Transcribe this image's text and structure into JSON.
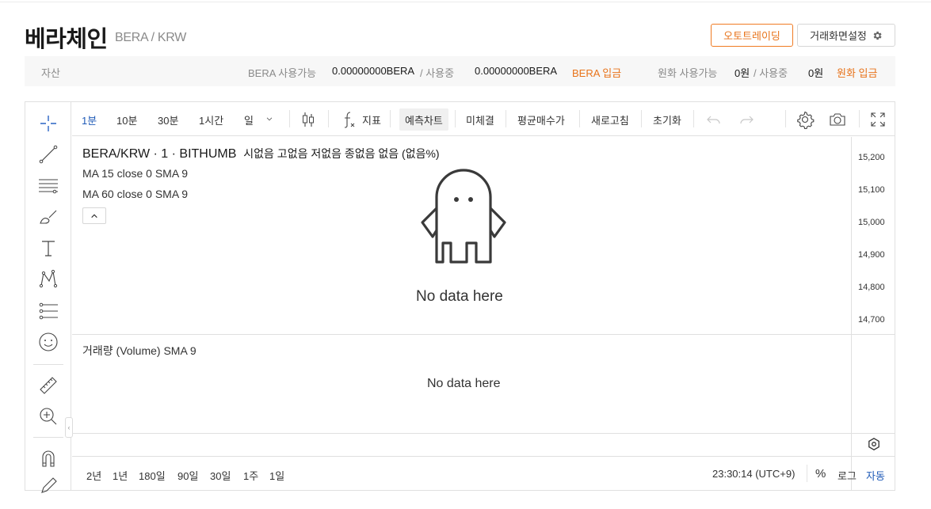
{
  "header": {
    "coin_name": "베라체인",
    "pair": "BERA / KRW",
    "auto_trading_label": "오토트레이딩",
    "screen_settings_label": "거래화면설정"
  },
  "asset_bar": {
    "asset_label": "자산",
    "bera_available_label": "BERA 사용가능",
    "bera_available_value": "0.00000000BERA",
    "bera_in_use_label": "/ 사용중",
    "bera_in_use_value": "0.00000000BERA",
    "bera_deposit_label": "BERA 입금",
    "krw_available_label": "원화 사용가능",
    "krw_available_value": "0원",
    "krw_in_use_label": "/ 사용중",
    "krw_in_use_value": "0원",
    "krw_deposit_label": "원화 입금"
  },
  "toolbar": {
    "intervals": [
      "1분",
      "10분",
      "30분",
      "1시간",
      "일"
    ],
    "active_interval": "1분",
    "indicator_label": "지표",
    "forecast_label": "예측차트",
    "unfilled_label": "미체결",
    "avg_price_label": "평균매수가",
    "refresh_label": "새로고침",
    "reset_label": "초기화"
  },
  "legend": {
    "symbol": "BERA/KRW · 1 · BITHUMB",
    "ohlc": "시없음 고없음 저없음 종없음 없음 (없음%)",
    "ma1": "MA 15 close 0 SMA 9",
    "ma2": "MA 60 close 0 SMA 9",
    "volume": "거래량 (Volume) SMA 9"
  },
  "messages": {
    "no_data_main": "No data here",
    "no_data_volume": "No data here"
  },
  "price_axis": {
    "ticks": [
      "15,200",
      "15,100",
      "15,000",
      "14,900",
      "14,800",
      "14,700"
    ]
  },
  "time_bar": {
    "ranges": [
      "2년",
      "1년",
      "180일",
      "90일",
      "30일",
      "1주",
      "1일"
    ],
    "clock": "23:30:14 (UTC+9)",
    "percent_label": "%",
    "log_label": "로그",
    "auto_label": "자동"
  },
  "colors": {
    "accent_orange": "#e8731a",
    "accent_blue": "#1f5bb7"
  }
}
